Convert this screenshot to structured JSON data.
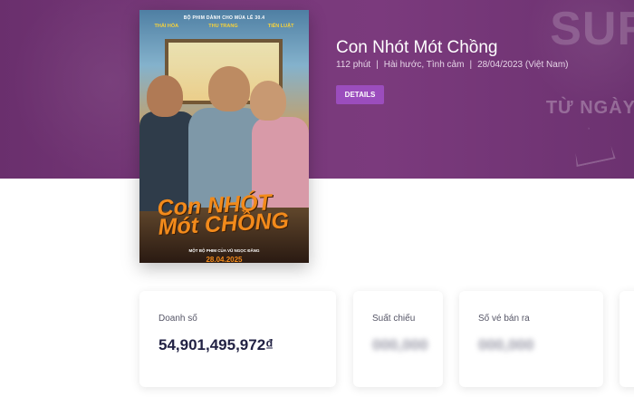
{
  "movie": {
    "title": "Con Nhót Mót Chồng",
    "duration": "112 phút",
    "genres": "Hài hước, Tình cảm",
    "release": "28/04/2023 (Việt Nam)",
    "details_label": "DETAILS"
  },
  "poster": {
    "tagline": "BỘ PHIM DÀNH CHO MÙA LỄ 30.4",
    "cast": [
      "THÁI HÒA",
      "THU TRANG",
      "TIẾN LUẬT"
    ],
    "title_line1": "Con NHÓT",
    "title_line2": "Mót CHỒNG",
    "director": "MỘT BỘ PHIM CỦA VŨ NGỌC ĐÃNG",
    "date": "28.04.2025"
  },
  "hero_deco": {
    "top_text": "SUR",
    "side_text": "TỪ NGÀY"
  },
  "stats": [
    {
      "label": "Doanh số",
      "value": "54,901,495,972₫"
    },
    {
      "label": "Suất chiếu",
      "value": "000,000"
    },
    {
      "label": "Số vé bán ra",
      "value": "000,000"
    }
  ],
  "colors": {
    "hero": "#78397a",
    "button": "#9b4dbd",
    "value_text": "#222244"
  }
}
